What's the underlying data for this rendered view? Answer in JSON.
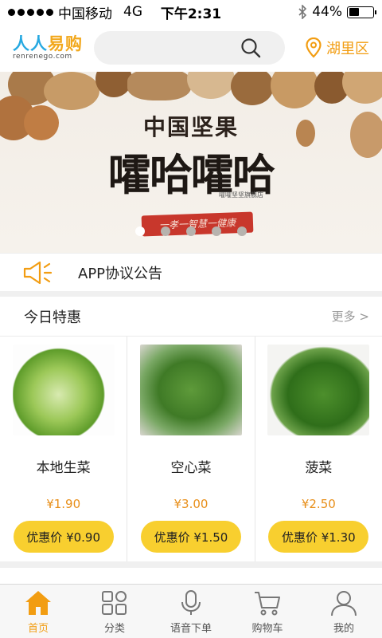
{
  "status_bar": {
    "carrier": "中国移动",
    "network": "4G",
    "time": "下午2:31",
    "battery": "44%",
    "battery_level": 0.44
  },
  "header": {
    "logo_text": "人人易购",
    "logo_sub": "renrenego.com",
    "search_placeholder": "",
    "location": "湖里区"
  },
  "banner": {
    "title_line1": "中国坚果",
    "title_line2": "嚯哈嚯哈",
    "small_text": "嚯嚯坚坚旗舰店",
    "ribbon_text": "一孝一智慧一健康",
    "slide_count": 5,
    "active_slide": 0
  },
  "notice": {
    "text": "APP协议公告",
    "icon": "megaphone-icon"
  },
  "deals": {
    "title": "今日特惠",
    "more": "更多 >",
    "items": [
      {
        "name": "本地生菜",
        "price": "¥1.90",
        "deal_label": "优惠价 ¥0.90"
      },
      {
        "name": "空心菜",
        "price": "¥3.00",
        "deal_label": "优惠价 ¥1.50"
      },
      {
        "name": "菠菜",
        "price": "¥2.50",
        "deal_label": "优惠价 ¥1.30"
      }
    ]
  },
  "tabs": [
    {
      "label": "首页",
      "icon": "home-icon",
      "active": true
    },
    {
      "label": "分类",
      "icon": "category-icon",
      "active": false
    },
    {
      "label": "语音下单",
      "icon": "microphone-icon",
      "active": false
    },
    {
      "label": "购物车",
      "icon": "cart-icon",
      "active": false
    },
    {
      "label": "我的",
      "icon": "user-icon",
      "active": false
    }
  ],
  "colors": {
    "accent": "#f29d12",
    "deal_button": "#f8cf2f",
    "price": "#e88f1a",
    "logo_blue": "#27a9e1"
  }
}
